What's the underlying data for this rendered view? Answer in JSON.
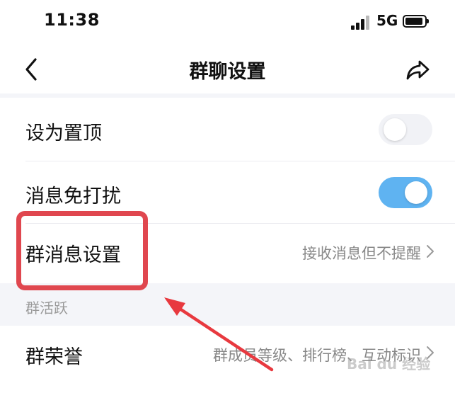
{
  "status_bar": {
    "time": "11:38",
    "network": "5G",
    "signal_icon": "signal-icon",
    "battery_icon": "battery-icon"
  },
  "nav": {
    "back_icon": "chevron-left-icon",
    "title": "群聊设置",
    "share_icon": "share-icon"
  },
  "settings": [
    {
      "label": "设为置顶",
      "control": "toggle",
      "checked": false
    },
    {
      "label": "消息免打扰",
      "control": "toggle",
      "checked": true
    },
    {
      "label": "群消息设置",
      "value": "接收消息但不提醒",
      "control": "disclosure"
    }
  ],
  "section": {
    "title": "群活跃"
  },
  "honor_row": {
    "label": "群荣誉",
    "value": "群成员等级、排行榜、互动标识",
    "control": "disclosure"
  },
  "colors": {
    "accent": "#5fb3f1",
    "annotation": "#e0474f",
    "section_bg": "#f4f5f9"
  },
  "watermark": {
    "text": "Bai du 经验"
  }
}
